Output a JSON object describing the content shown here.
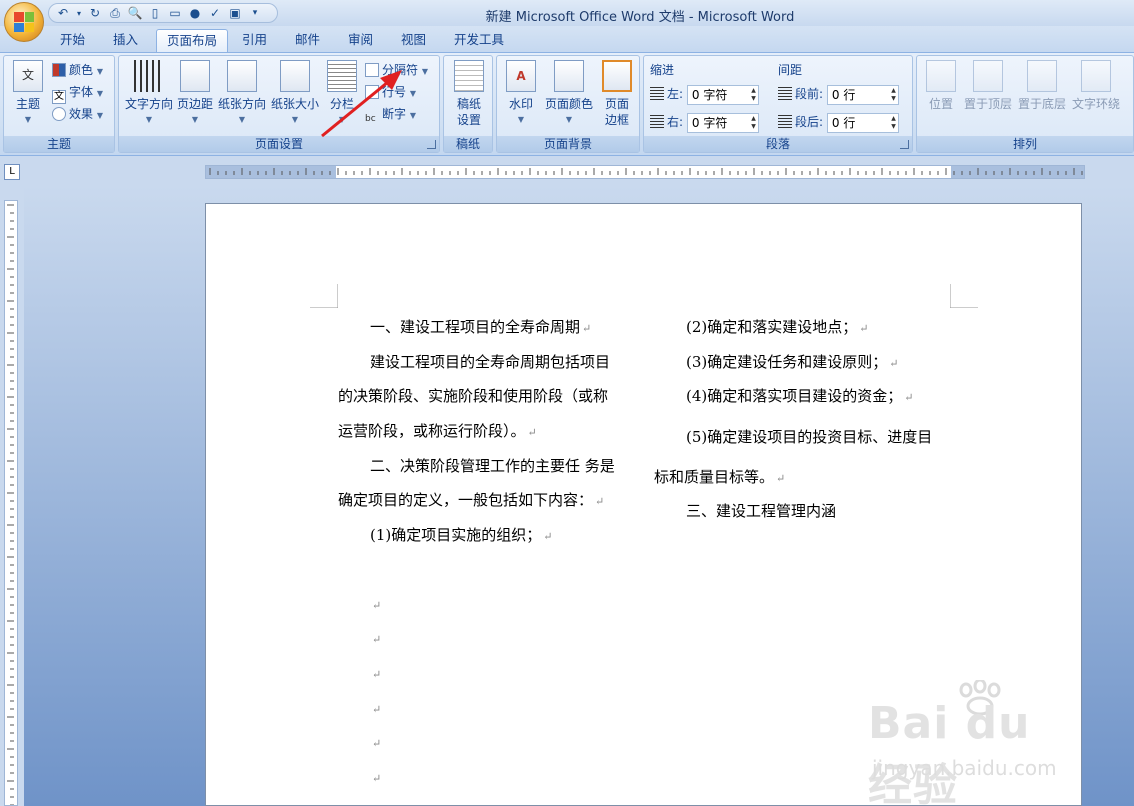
{
  "window": {
    "title": "新建 Microsoft Office Word 文档 - Microsoft Word"
  },
  "tabs": [
    {
      "label": "开始",
      "active": false
    },
    {
      "label": "插入",
      "active": false
    },
    {
      "label": "页面布局",
      "active": true
    },
    {
      "label": "引用",
      "active": false
    },
    {
      "label": "邮件",
      "active": false
    },
    {
      "label": "审阅",
      "active": false
    },
    {
      "label": "视图",
      "active": false
    },
    {
      "label": "开发工具",
      "active": false
    }
  ],
  "ribbon": {
    "theme": {
      "label": "主题",
      "theme_btn": "主题",
      "colors": "颜色",
      "fonts": "字体",
      "effects": "效果"
    },
    "page_setup": {
      "label": "页面设置",
      "text_direction": "文字方向",
      "margins": "页边距",
      "orientation": "纸张方向",
      "size": "纸张大小",
      "columns": "分栏",
      "breaks": "分隔符",
      "line_numbers": "行号",
      "hyphenation": "断字"
    },
    "manuscript": {
      "label": "稿纸",
      "btn_line1": "稿纸",
      "btn_line2": "设置"
    },
    "page_background": {
      "label": "页面背景",
      "watermark": "水印",
      "page_color": "页面颜色",
      "borders_line1": "页面",
      "borders_line2": "边框"
    },
    "paragraph": {
      "label": "段落",
      "indent_label": "缩进",
      "spacing_label": "间距",
      "left": "左:",
      "right": "右:",
      "before": "段前:",
      "after": "段后:",
      "left_value": "0 字符",
      "right_value": "0 字符",
      "before_value": "0 行",
      "after_value": "0 行"
    },
    "arrange": {
      "label": "排列",
      "position": "位置",
      "bring_front": "置于顶层",
      "send_back": "置于底层",
      "wrap": "文字环绕"
    }
  },
  "document": {
    "left_column": [
      "一、建设工程项目的全寿命周期",
      "建设工程项目的全寿命周期包括项目",
      "的决策阶段、实施阶段和使用阶段（或称",
      "运营阶段，或称运行阶段）。",
      "二、决策阶段管理工作的主要任 务是",
      "确定项目的定义，一般包括如下内容：",
      "(1)确定项目实施的组织；"
    ],
    "right_column": [
      "(2)确定和落实建设地点；",
      "(3)确定建设任务和建设原则；",
      "(4)确定和落实项目建设的资金；",
      "(5)确定建设项目的投资目标、进度目",
      "标和质量目标等。",
      "三、建设工程管理内涵"
    ],
    "paragraph_mark": "↵"
  },
  "watermark": {
    "brand": "Bai du 经验",
    "url": "jingyan.baidu.com"
  },
  "colors": {
    "accent": "#15428b",
    "arrow": "#e02020"
  }
}
